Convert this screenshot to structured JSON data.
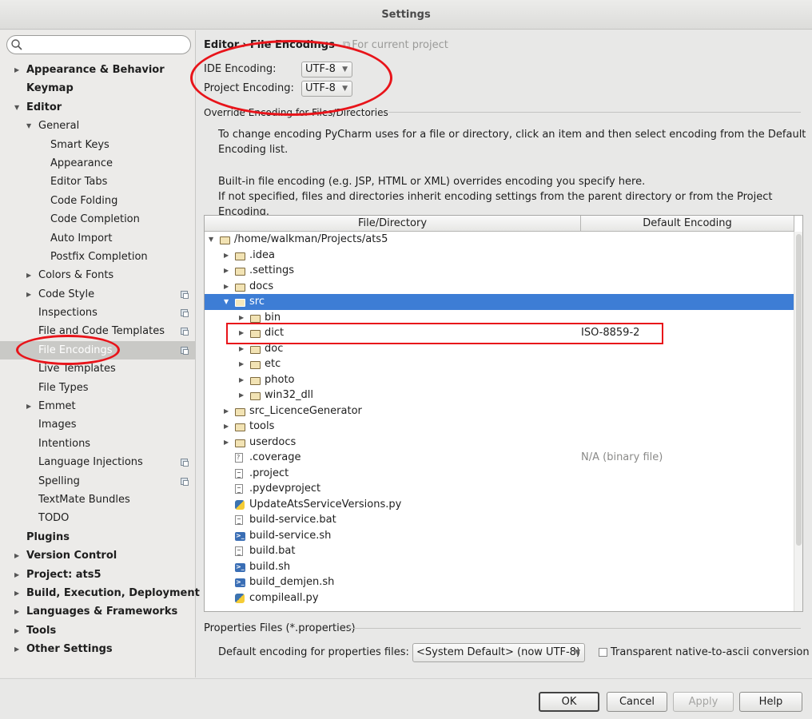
{
  "window": {
    "title": "Settings"
  },
  "sidebar": {
    "search_placeholder": "",
    "items": [
      {
        "label": "Appearance & Behavior",
        "level": 0,
        "toggle": "collapsed",
        "bold": true
      },
      {
        "label": "Keymap",
        "level": 0,
        "toggle": "none",
        "bold": true
      },
      {
        "label": "Editor",
        "level": 0,
        "toggle": "expanded",
        "bold": true
      },
      {
        "label": "General",
        "level": 1,
        "toggle": "expanded"
      },
      {
        "label": "Smart Keys",
        "level": 2,
        "toggle": "none"
      },
      {
        "label": "Appearance",
        "level": 2,
        "toggle": "none"
      },
      {
        "label": "Editor Tabs",
        "level": 2,
        "toggle": "none"
      },
      {
        "label": "Code Folding",
        "level": 2,
        "toggle": "none"
      },
      {
        "label": "Code Completion",
        "level": 2,
        "toggle": "none"
      },
      {
        "label": "Auto Import",
        "level": 2,
        "toggle": "none"
      },
      {
        "label": "Postfix Completion",
        "level": 2,
        "toggle": "none"
      },
      {
        "label": "Colors & Fonts",
        "level": 1,
        "toggle": "collapsed"
      },
      {
        "label": "Code Style",
        "level": 1,
        "toggle": "collapsed",
        "copy": true
      },
      {
        "label": "Inspections",
        "level": 1,
        "toggle": "none",
        "copy": true
      },
      {
        "label": "File and Code Templates",
        "level": 1,
        "toggle": "none",
        "copy": true
      },
      {
        "label": "File Encodings",
        "level": 1,
        "toggle": "none",
        "copy": true,
        "selected": true
      },
      {
        "label": "Live Templates",
        "level": 1,
        "toggle": "none"
      },
      {
        "label": "File Types",
        "level": 1,
        "toggle": "none"
      },
      {
        "label": "Emmet",
        "level": 1,
        "toggle": "collapsed"
      },
      {
        "label": "Images",
        "level": 1,
        "toggle": "none"
      },
      {
        "label": "Intentions",
        "level": 1,
        "toggle": "none"
      },
      {
        "label": "Language Injections",
        "level": 1,
        "toggle": "none",
        "copy": true
      },
      {
        "label": "Spelling",
        "level": 1,
        "toggle": "none",
        "copy": true
      },
      {
        "label": "TextMate Bundles",
        "level": 1,
        "toggle": "none"
      },
      {
        "label": "TODO",
        "level": 1,
        "toggle": "none"
      },
      {
        "label": "Plugins",
        "level": 0,
        "toggle": "none",
        "bold": true
      },
      {
        "label": "Version Control",
        "level": 0,
        "toggle": "collapsed",
        "bold": true
      },
      {
        "label": "Project: ats5",
        "level": 0,
        "toggle": "collapsed",
        "bold": true
      },
      {
        "label": "Build, Execution, Deployment",
        "level": 0,
        "toggle": "collapsed",
        "bold": true
      },
      {
        "label": "Languages & Frameworks",
        "level": 0,
        "toggle": "collapsed",
        "bold": true
      },
      {
        "label": "Tools",
        "level": 0,
        "toggle": "collapsed",
        "bold": true
      },
      {
        "label": "Other Settings",
        "level": 0,
        "toggle": "collapsed",
        "bold": true
      }
    ]
  },
  "breadcrumb": {
    "parent": "Editor",
    "separator": "›",
    "current": "File Encodings",
    "scope": "For current project"
  },
  "ide_encoding": {
    "label": "IDE Encoding:",
    "value": "UTF-8"
  },
  "project_encoding": {
    "label": "Project Encoding:",
    "value": "UTF-8"
  },
  "override_section": {
    "title": "Override Encoding for Files/Directories",
    "desc1": "To change encoding PyCharm uses for a file or directory, click an item and then select encoding from the Default Encoding list.",
    "desc2": "Built-in file encoding (e.g. JSP, HTML or XML) overrides encoding you specify here.",
    "desc3": "If not specified, files and directories inherit encoding settings from the parent directory or from the Project Encoding."
  },
  "table": {
    "col_file": "File/Directory",
    "col_encoding": "Default Encoding",
    "rows": [
      {
        "name": "/home/walkman/Projects/ats5",
        "depth": 0,
        "icon": "folder",
        "toggle": "expanded",
        "encoding": ""
      },
      {
        "name": ".idea",
        "depth": 1,
        "icon": "folder",
        "toggle": "collapsed",
        "encoding": ""
      },
      {
        "name": ".settings",
        "depth": 1,
        "icon": "folder",
        "toggle": "collapsed",
        "encoding": ""
      },
      {
        "name": "docs",
        "depth": 1,
        "icon": "folder",
        "toggle": "collapsed",
        "encoding": ""
      },
      {
        "name": "src",
        "depth": 1,
        "icon": "folder",
        "toggle": "expanded",
        "encoding": "",
        "selected": true
      },
      {
        "name": "bin",
        "depth": 2,
        "icon": "folder",
        "toggle": "collapsed",
        "encoding": ""
      },
      {
        "name": "dict",
        "depth": 2,
        "icon": "folder",
        "toggle": "collapsed",
        "encoding": "ISO-8859-2"
      },
      {
        "name": "doc",
        "depth": 2,
        "icon": "folder",
        "toggle": "collapsed",
        "encoding": ""
      },
      {
        "name": "etc",
        "depth": 2,
        "icon": "folder",
        "toggle": "collapsed",
        "encoding": ""
      },
      {
        "name": "photo",
        "depth": 2,
        "icon": "folder",
        "toggle": "collapsed",
        "encoding": ""
      },
      {
        "name": "win32_dll",
        "depth": 2,
        "icon": "folder",
        "toggle": "collapsed",
        "encoding": ""
      },
      {
        "name": "src_LicenceGenerator",
        "depth": 1,
        "icon": "folder",
        "toggle": "collapsed",
        "encoding": ""
      },
      {
        "name": "tools",
        "depth": 1,
        "icon": "folder",
        "toggle": "collapsed",
        "encoding": ""
      },
      {
        "name": "userdocs",
        "depth": 1,
        "icon": "folder",
        "toggle": "collapsed",
        "encoding": ""
      },
      {
        "name": ".coverage",
        "depth": 1,
        "icon": "file-unknown",
        "toggle": "none",
        "encoding": "N/A (binary file)",
        "gray": true
      },
      {
        "name": ".project",
        "depth": 1,
        "icon": "file-text",
        "toggle": "none",
        "encoding": ""
      },
      {
        "name": ".pydevproject",
        "depth": 1,
        "icon": "file-text",
        "toggle": "none",
        "encoding": ""
      },
      {
        "name": "UpdateAtsServiceVersions.py",
        "depth": 1,
        "icon": "python",
        "toggle": "none",
        "encoding": ""
      },
      {
        "name": "build-service.bat",
        "depth": 1,
        "icon": "file-text",
        "toggle": "none",
        "encoding": ""
      },
      {
        "name": "build-service.sh",
        "depth": 1,
        "icon": "shell",
        "toggle": "none",
        "encoding": ""
      },
      {
        "name": "build.bat",
        "depth": 1,
        "icon": "file-text",
        "toggle": "none",
        "encoding": ""
      },
      {
        "name": "build.sh",
        "depth": 1,
        "icon": "shell",
        "toggle": "none",
        "encoding": ""
      },
      {
        "name": "build_demjen.sh",
        "depth": 1,
        "icon": "shell",
        "toggle": "none",
        "encoding": ""
      },
      {
        "name": "compileall.py",
        "depth": 1,
        "icon": "python",
        "toggle": "none",
        "encoding": ""
      }
    ]
  },
  "properties": {
    "section_title": "Properties Files (*.properties)",
    "default_label": "Default encoding for properties files:",
    "default_value": "<System Default> (now UTF-8)",
    "transparent_label": "Transparent native-to-ascii conversion",
    "transparent_checked": false
  },
  "buttons": {
    "ok": "OK",
    "cancel": "Cancel",
    "apply": "Apply",
    "help": "Help"
  },
  "colors": {
    "annotation": "#e8141a",
    "selection": "#3d7dd5",
    "sidebar_selected": "#c9c9c6"
  }
}
